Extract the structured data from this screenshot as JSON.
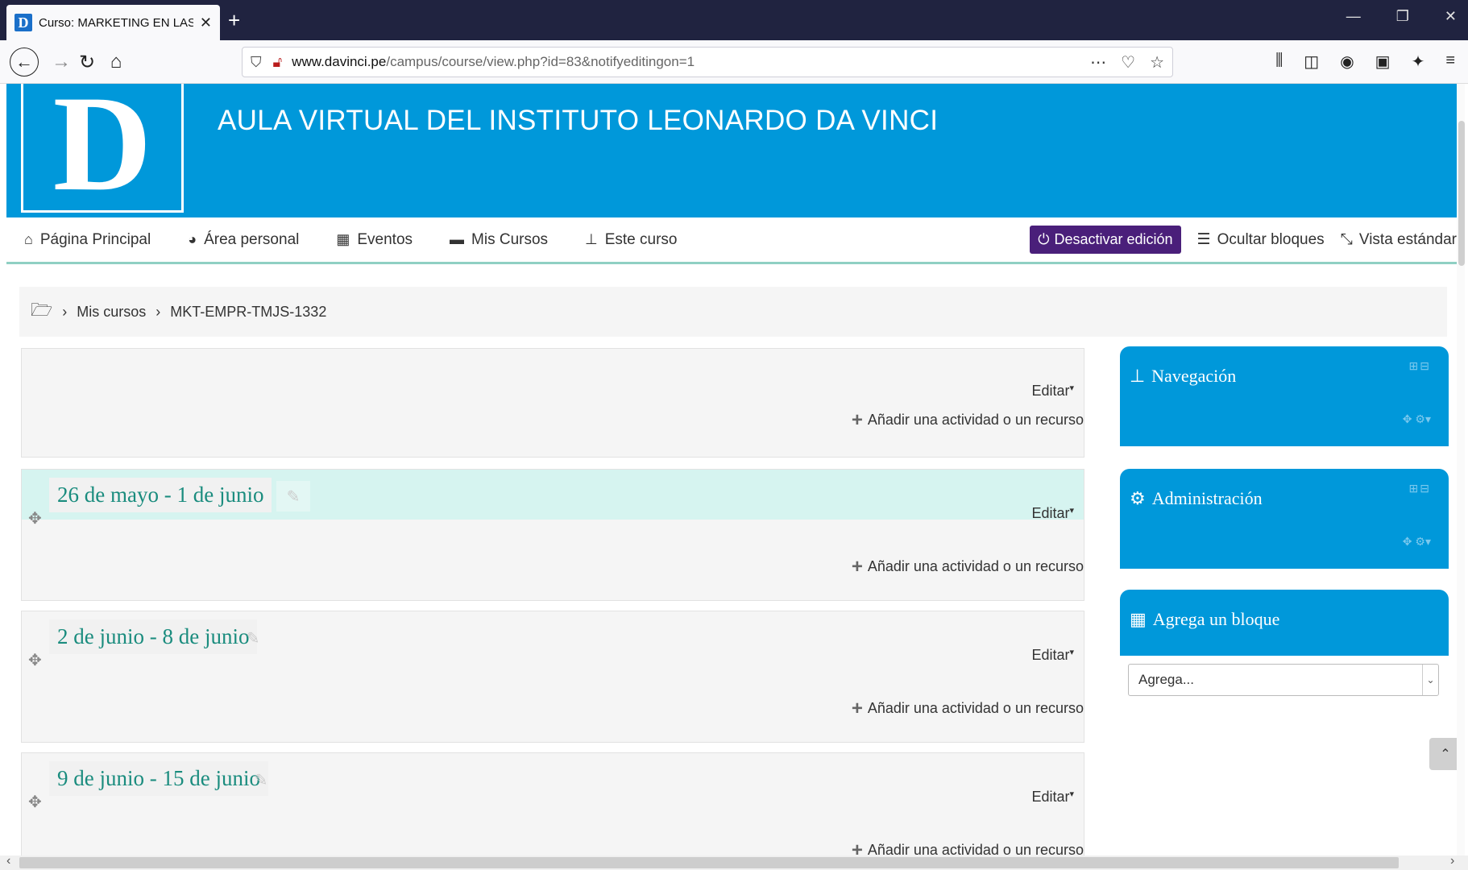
{
  "browser": {
    "tab_title": "Curso: MARKETING EN LAS EMP",
    "tab_favicon": "D",
    "url_domain": "www.davinci.pe",
    "url_path": "/campus/course/view.php?id=83&notifyeditingon=1"
  },
  "header": {
    "logo_letter": "D",
    "site_title": "AULA VIRTUAL DEL INSTITUTO LEONARDO DA VINCI"
  },
  "menu": {
    "home": "Página Principal",
    "personal": "Área personal",
    "events": "Eventos",
    "my_courses": "Mis Cursos",
    "this_course": "Este curso",
    "toggle_edit": "Desactivar edición",
    "hide_blocks": "Ocultar bloques",
    "standard_view": "Vista estándar"
  },
  "breadcrumb": {
    "item1": "Mis cursos",
    "item2": "MKT-EMPR-TMJS-1332"
  },
  "sections": {
    "edit_label": "Editar",
    "add_label": "Añadir una actividad o un recurso",
    "s1_title": "26 de mayo - 1 de junio",
    "s2_title": "2 de junio - 8 de junio",
    "s3_title": "9 de junio - 15 de junio"
  },
  "blocks": {
    "navigation": "Navegación",
    "administration": "Administración",
    "add_block": "Agrega un bloque",
    "add_block_select": "Agrega..."
  },
  "colors": {
    "brand": "#0098da",
    "edit_button": "#4a1f7a",
    "section_title": "#1a8c7e"
  }
}
